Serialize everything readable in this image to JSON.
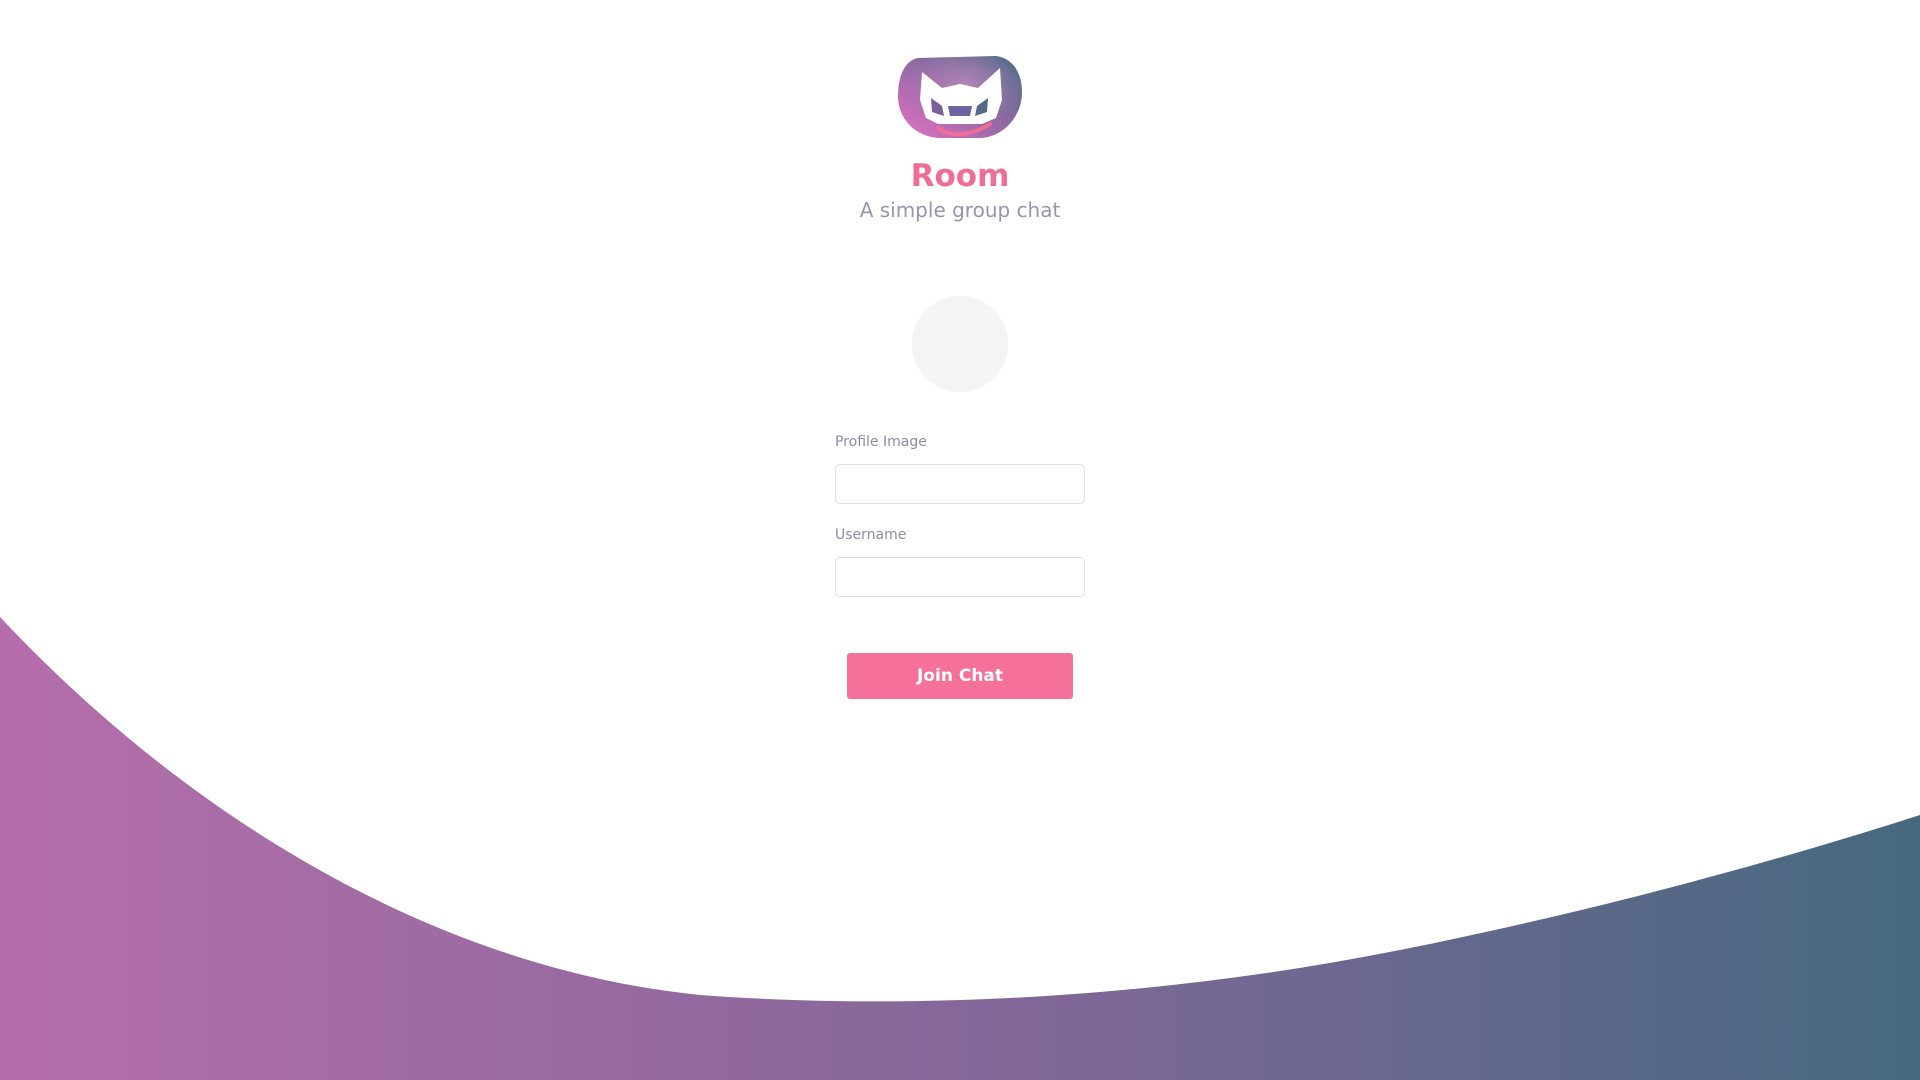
{
  "app": {
    "title": "Room",
    "subtitle": "A simple group chat"
  },
  "icons": {
    "logo": "cat-face-logo-icon",
    "avatar": "profile-avatar-placeholder"
  },
  "form": {
    "profile_image_label": "Profile Image",
    "profile_image_value": "",
    "username_label": "Username",
    "username_value": "",
    "submit_label": "Join Chat"
  },
  "colors": {
    "accent": "#f6719a",
    "title": "#f06e96",
    "muted_text": "#9a93b0",
    "wave_start": "#b56eab",
    "wave_end": "#46697f"
  }
}
